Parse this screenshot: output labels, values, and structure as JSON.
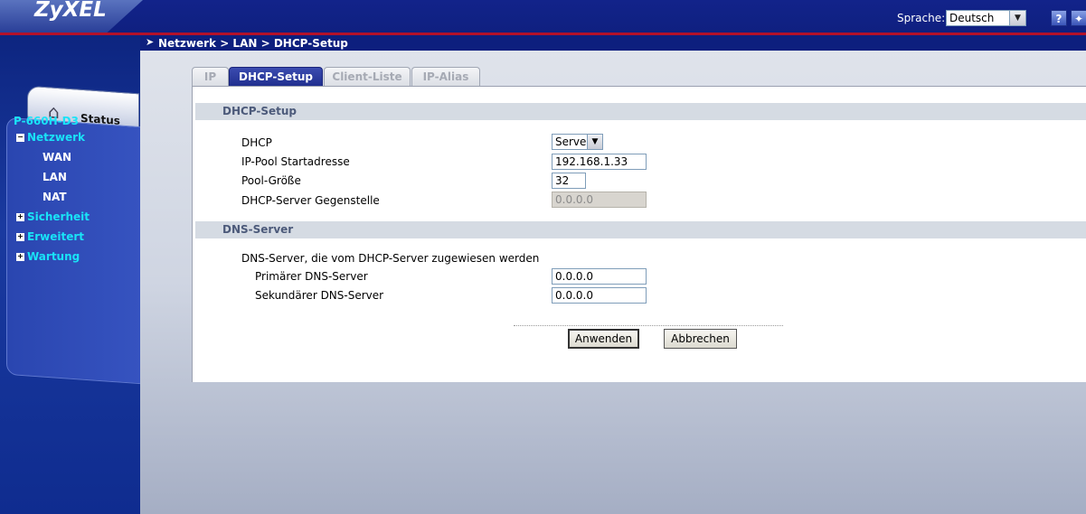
{
  "header": {
    "logo": "ZyXEL",
    "language_label": "Sprache:",
    "language_value": "Deutsch",
    "help_icon": "?",
    "wizard_icon": "✦"
  },
  "sidebar": {
    "status_label": "Status",
    "device_name": "P-660H-D3",
    "items": [
      {
        "label": "Netzwerk",
        "expanded": true,
        "sub": [
          "WAN",
          "LAN",
          "NAT"
        ]
      },
      {
        "label": "Sicherheit",
        "expanded": false
      },
      {
        "label": "Erweitert",
        "expanded": false
      },
      {
        "label": "Wartung",
        "expanded": false
      }
    ]
  },
  "breadcrumb": "Netzwerk > LAN > DHCP-Setup",
  "tabs": [
    {
      "label": "IP",
      "active": false
    },
    {
      "label": "DHCP-Setup",
      "active": true
    },
    {
      "label": "Client-Liste",
      "active": false
    },
    {
      "label": "IP-Alias",
      "active": false
    }
  ],
  "dhcp_section": {
    "title": "DHCP-Setup",
    "dhcp_label": "DHCP",
    "dhcp_value": "Server",
    "pool_start_label": "IP-Pool Startadresse",
    "pool_start_value": "192.168.1.33",
    "pool_size_label": "Pool-Größe",
    "pool_size_value": "32",
    "remote_label": "DHCP-Server Gegenstelle",
    "remote_value": "0.0.0.0"
  },
  "dns_section": {
    "title": "DNS-Server",
    "description": "DNS-Server, die vom DHCP-Server zugewiesen werden",
    "primary_label": "Primärer DNS-Server",
    "primary_value": "0.0.0.0",
    "secondary_label": "Sekundärer DNS-Server",
    "secondary_value": "0.0.0.0"
  },
  "buttons": {
    "apply": "Anwenden",
    "cancel": "Abbrechen"
  },
  "colors": {
    "nav_top": "#19e3f7",
    "header_bg": "#12238a",
    "accent_red": "#b3112a",
    "active_tab": "#1e2c8c"
  }
}
